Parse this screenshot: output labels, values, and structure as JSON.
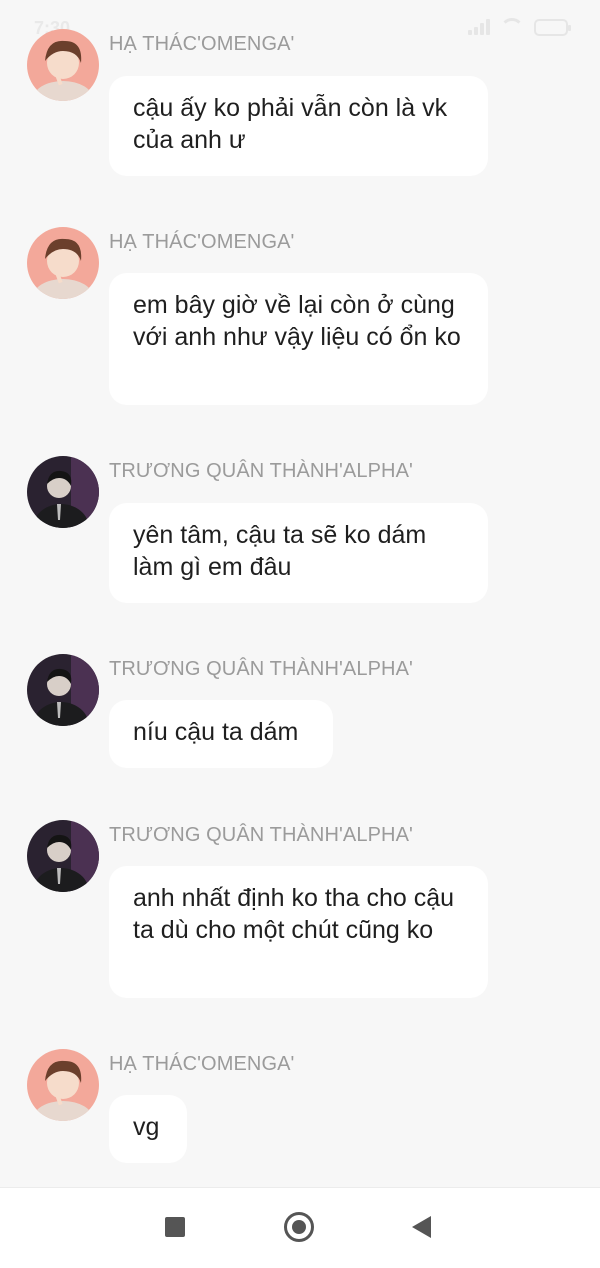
{
  "status_bar": {
    "time": "7:30",
    "icons": [
      "signal-icon",
      "wifi-icon",
      "battery-icon"
    ]
  },
  "messages": [
    {
      "sender": "HẠ THÁC'OMENGA'",
      "text": "cậu ấy ko phải vẫn còn là vk của anh ư",
      "avatar": "omega-avatar"
    },
    {
      "sender": "HẠ THÁC'OMENGA'",
      "text": "em bây giờ về lại còn ở cùng với anh như vậy liệu có ổn ko",
      "avatar": "omega-avatar"
    },
    {
      "sender": "TRƯƠNG QUÂN THÀNH'ALPHA'",
      "text": "yên tâm, cậu ta sẽ ko dám làm gì em đâu",
      "avatar": "alpha-avatar"
    },
    {
      "sender": "TRƯƠNG QUÂN THÀNH'ALPHA'",
      "text": "níu cậu ta dám",
      "avatar": "alpha-avatar"
    },
    {
      "sender": "TRƯƠNG QUÂN THÀNH'ALPHA'",
      "text": "anh nhất định ko tha cho cậu ta dù cho một chút cũng ko",
      "avatar": "alpha-avatar"
    },
    {
      "sender": "HẠ THÁC'OMENGA'",
      "text": "vg",
      "avatar": "omega-avatar"
    }
  ],
  "nav_bar": {
    "buttons": [
      "recent-apps-button",
      "home-button",
      "back-button"
    ]
  },
  "colors": {
    "background": "#f7f7f7",
    "bubble": "#ffffff",
    "sender_text": "#9b9b9b",
    "message_text": "#1f1f1f"
  }
}
